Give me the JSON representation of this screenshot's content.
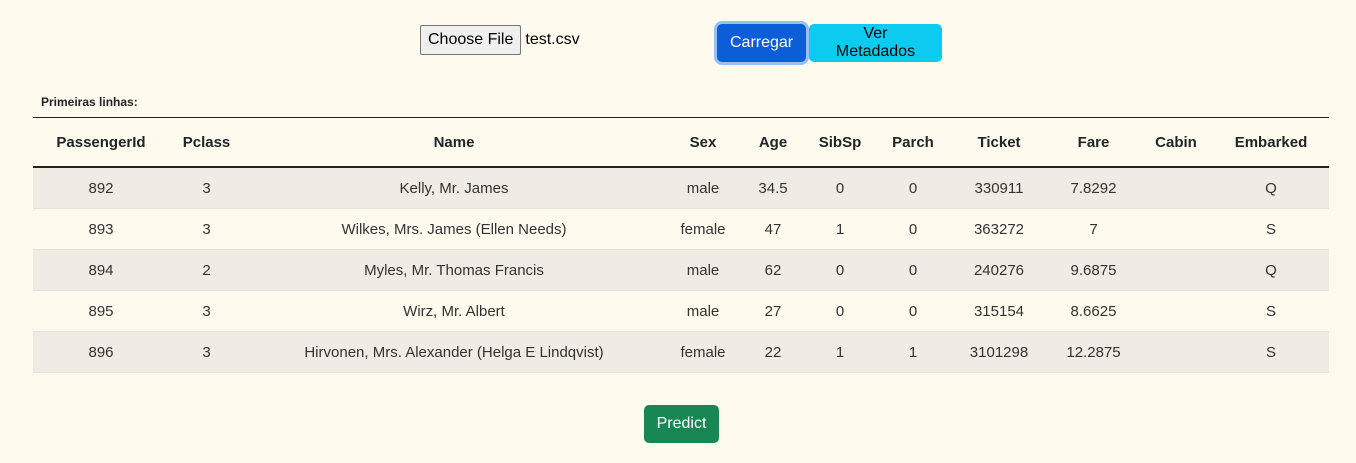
{
  "upload": {
    "choose_file_label": "Choose File",
    "file_name": "test.csv"
  },
  "buttons": {
    "carregar": "Carregar",
    "ver_metadados": "Ver Metadados",
    "predict": "Predict"
  },
  "preview": {
    "caption": "Primeiras linhas:",
    "columns": [
      "PassengerId",
      "Pclass",
      "Name",
      "Sex",
      "Age",
      "SibSp",
      "Parch",
      "Ticket",
      "Fare",
      "Cabin",
      "Embarked"
    ],
    "rows": [
      [
        "892",
        "3",
        "Kelly, Mr. James",
        "male",
        "34.5",
        "0",
        "0",
        "330911",
        "7.8292",
        "",
        "Q"
      ],
      [
        "893",
        "3",
        "Wilkes, Mrs. James (Ellen Needs)",
        "female",
        "47",
        "1",
        "0",
        "363272",
        "7",
        "",
        "S"
      ],
      [
        "894",
        "2",
        "Myles, Mr. Thomas Francis",
        "male",
        "62",
        "0",
        "0",
        "240276",
        "9.6875",
        "",
        "Q"
      ],
      [
        "895",
        "3",
        "Wirz, Mr. Albert",
        "male",
        "27",
        "0",
        "0",
        "315154",
        "8.6625",
        "",
        "S"
      ],
      [
        "896",
        "3",
        "Hirvonen, Mrs. Alexander (Helga E Lindqvist)",
        "female",
        "22",
        "1",
        "1",
        "3101298",
        "12.2875",
        "",
        "S"
      ]
    ]
  },
  "colors": {
    "background": "#fefaee",
    "primary": "#0b5ed7",
    "info": "#0dcaf0",
    "success": "#198754",
    "stripe": "#f0ece3"
  }
}
